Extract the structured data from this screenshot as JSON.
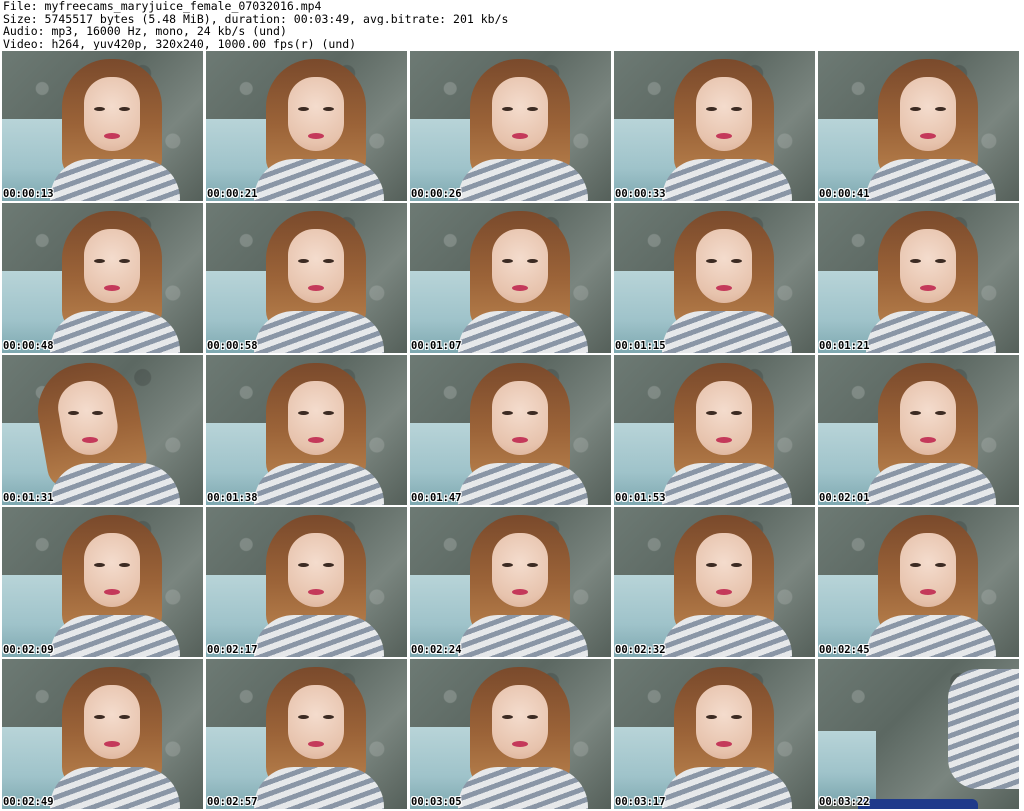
{
  "header": {
    "file": "File: myfreecams_maryjuice_female_07032016.mp4",
    "size": "Size: 5745517 bytes (5.48 MiB), duration: 00:03:49, avg.bitrate: 201 kb/s",
    "audio": "Audio: mp3, 16000 Hz, mono, 24 kb/s (und)",
    "video": "Video: h264, yuv420p, 320x240, 1000.00 fps(r) (und)"
  },
  "thumbnails": [
    {
      "time": "00:00:13"
    },
    {
      "time": "00:00:21"
    },
    {
      "time": "00:00:26"
    },
    {
      "time": "00:00:33"
    },
    {
      "time": "00:00:41"
    },
    {
      "time": "00:00:48"
    },
    {
      "time": "00:00:58"
    },
    {
      "time": "00:01:07"
    },
    {
      "time": "00:01:15"
    },
    {
      "time": "00:01:21"
    },
    {
      "time": "00:01:31"
    },
    {
      "time": "00:01:38"
    },
    {
      "time": "00:01:47"
    },
    {
      "time": "00:01:53"
    },
    {
      "time": "00:02:01"
    },
    {
      "time": "00:02:09"
    },
    {
      "time": "00:02:17"
    },
    {
      "time": "00:02:24"
    },
    {
      "time": "00:02:32"
    },
    {
      "time": "00:02:45"
    },
    {
      "time": "00:02:49"
    },
    {
      "time": "00:02:57"
    },
    {
      "time": "00:03:05"
    },
    {
      "time": "00:03:17"
    },
    {
      "time": "00:03:22"
    }
  ]
}
